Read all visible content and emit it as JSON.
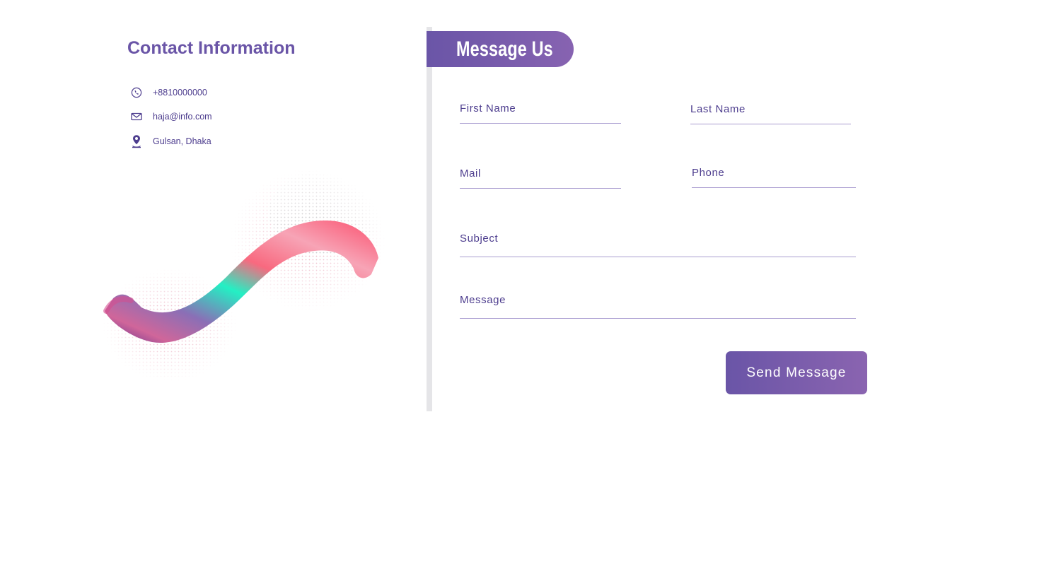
{
  "contact": {
    "title": "Contact Information",
    "phone": {
      "icon": "phone-icon",
      "value": "+8810000000"
    },
    "email": {
      "icon": "mail-icon",
      "value": "haja@info.com"
    },
    "address": {
      "icon": "location-pin-icon",
      "value": "Gulsan, Dhaka"
    }
  },
  "form": {
    "title": "Message Us",
    "fields": {
      "first_name": {
        "label": "First Name",
        "value": ""
      },
      "last_name": {
        "label": "Last Name",
        "value": ""
      },
      "mail": {
        "label": "Mail",
        "value": ""
      },
      "phone": {
        "label": "Phone",
        "value": ""
      },
      "subject": {
        "label": "Subject",
        "value": ""
      },
      "message": {
        "label": "Message",
        "value": ""
      }
    },
    "submit_label": "Send Message"
  },
  "colors": {
    "primary": "#6a55a7",
    "primary_light": "#8763b1",
    "text": "#4d3d8e",
    "underline": "#a99cd0",
    "divider": "#e5e5e8",
    "accent_teal": "#23f0c4",
    "accent_pink": "#f8697f"
  }
}
